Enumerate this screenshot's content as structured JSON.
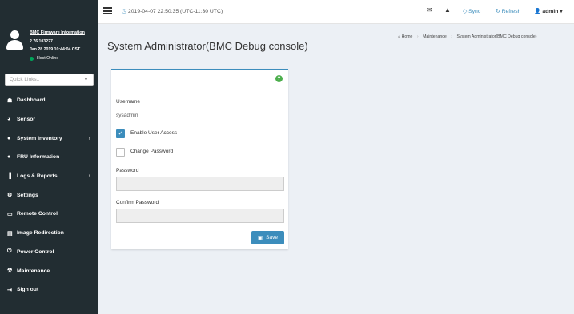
{
  "sidebar": {
    "firmware_title": "BMC Firmware Information",
    "firmware_version": "2.76.103227",
    "firmware_date": "Jan 28 2019 10:44:04 CST",
    "host_status": "Host Online",
    "quick_links_placeholder": "Quick Links..",
    "items": [
      {
        "label": "Dashboard",
        "icon": "dashboard-icon",
        "glyph": "☗"
      },
      {
        "label": "Sensor",
        "icon": "sensor-icon",
        "glyph": "◕"
      },
      {
        "label": "System Inventory",
        "icon": "info-icon",
        "glyph": "●"
      },
      {
        "label": "FRU Information",
        "icon": "info-icon",
        "glyph": "●"
      },
      {
        "label": "Logs & Reports",
        "icon": "bar-chart-icon",
        "glyph": "▐"
      },
      {
        "label": "Settings",
        "icon": "gear-icon",
        "glyph": "⚙"
      },
      {
        "label": "Remote Control",
        "icon": "monitor-icon",
        "glyph": "▭"
      },
      {
        "label": "Image Redirection",
        "icon": "drive-icon",
        "glyph": "▤"
      },
      {
        "label": "Power Control",
        "icon": "power-icon",
        "glyph": "⏻"
      },
      {
        "label": "Maintenance",
        "icon": "wrench-icon",
        "glyph": "⚒"
      },
      {
        "label": "Sign out",
        "icon": "sign-out-icon",
        "glyph": "⇥"
      }
    ]
  },
  "topbar": {
    "datetime": "2019-04-07 22:50:35 (UTC-11:30 UTC)",
    "sync_label": "Sync",
    "refresh_label": "Refresh",
    "user_label": "admin"
  },
  "page": {
    "title": "System Administrator(BMC Debug console)",
    "breadcrumb": {
      "home": "Home",
      "parent": "Maintenance",
      "current": "System Administrator(BMC Debug console)"
    }
  },
  "form": {
    "username_label": "Username",
    "username_value": "sysadmin",
    "enable_access_label": "Enable User Access",
    "enable_access_checked": true,
    "change_password_label": "Change Password",
    "change_password_checked": false,
    "password_label": "Password",
    "confirm_password_label": "Confirm Password",
    "save_label": "Save"
  },
  "colors": {
    "sidebar_bg": "#222d32",
    "accent": "#3c8dbc",
    "help_green": "#4cae4c",
    "online_green": "#00a65a"
  }
}
